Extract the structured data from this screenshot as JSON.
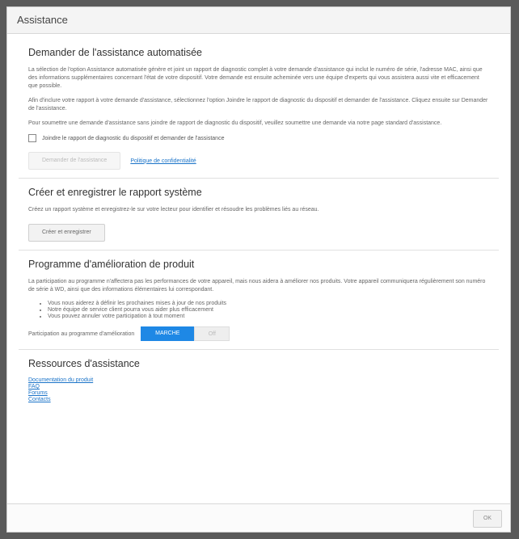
{
  "dialog": {
    "title": "Assistance"
  },
  "auto": {
    "heading": "Demander de l'assistance automatisée",
    "p1": "La sélection de l'option Assistance automatisée génère et joint un rapport de diagnostic complet à votre demande d'assistance qui inclut le numéro de série, l'adresse MAC, ainsi que des informations supplémentaires concernant l'état de votre dispositif. Votre demande est ensuite acheminée vers une équipe d'experts qui vous assistera aussi vite et efficacement que possible.",
    "p2": "Afin d'inclure votre rapport à votre demande d'assistance, sélectionnez l'option Joindre le rapport de diagnostic du dispositif et demander de l'assistance. Cliquez ensuite sur Demander de l'assistance.",
    "p3": "Pour soumettre une demande d'assistance sans joindre de rapport de diagnostic du dispositif, veuillez soumettre une demande via notre page standard d'assistance.",
    "checkbox_label": "Joindre le rapport de diagnostic du dispositif et demander de l'assistance",
    "request_button": "Demander de l'assistance",
    "privacy_link": "Politique de confidentialité"
  },
  "report": {
    "heading": "Créer et enregistrer le rapport système",
    "p1": "Créez un rapport système et enregistrez-le sur votre lecteur pour identifier et résoudre les problèmes liés au réseau.",
    "button": "Créer et enregistrer"
  },
  "program": {
    "heading": "Programme d'amélioration de produit",
    "p1": "La participation au programme n'affectera pas les performances de votre appareil, mais nous aidera à améliorer nos produits. Votre appareil communiquera régulièrement son numéro de série à WD, ainsi que des informations élémentaires lui correspondant.",
    "bullets": [
      "Vous nous aiderez à définir les prochaines mises à jour de nos produits",
      "Notre équipe de service client pourra vous aider plus efficacement",
      "Vous pouvez annuler votre participation à tout moment"
    ],
    "toggle_label": "Participation au programme d'amélioration",
    "toggle_on": "MARCHE",
    "toggle_off": "Off"
  },
  "resources": {
    "heading": "Ressources d'assistance",
    "links": [
      "Documentation du produit",
      "FAQ",
      "Forums",
      "Contacts"
    ]
  },
  "footer": {
    "ok": "OK"
  }
}
